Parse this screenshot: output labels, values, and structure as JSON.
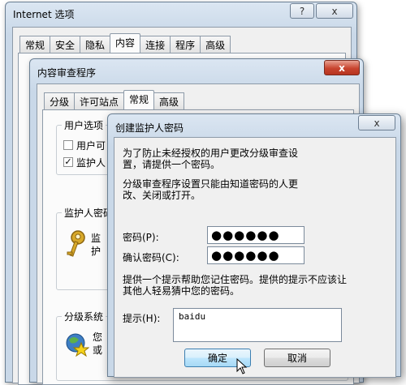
{
  "internet_options": {
    "title": "Internet 选项",
    "help_button": "?",
    "close_button": "x",
    "tabs": [
      "常规",
      "安全",
      "隐私",
      "内容",
      "连接",
      "程序",
      "高级"
    ],
    "active_tab": "内容"
  },
  "content_advisor": {
    "title": "内容审查程序",
    "close_button": "x",
    "tabs": [
      "分级",
      "许可站点",
      "常规",
      "高级"
    ],
    "active_tab": "常规",
    "user_options": {
      "title": "用户选项",
      "option1_partial": "用户可",
      "option2_partial": "监护人"
    },
    "supervisor_password": {
      "title": "监护人密码",
      "text_partial_line1": "监",
      "text_partial_line2": "护"
    },
    "rating_systems": {
      "title": "分级系统",
      "text_partial_line1": "您",
      "text_partial_line2": "或"
    }
  },
  "create_password": {
    "title": "创建监护人密码",
    "close_button": "x",
    "description1": "为了防止未经授权的用户更改分级审查设置，请提供一个密码。",
    "description2": "分级审查程序设置只能由知道密码的人更改、关闭或打开。",
    "password_label": "密码(P):",
    "password_value": "●●●●●●",
    "confirm_label": "确认密码(C):",
    "confirm_value": "●●●●●●",
    "hint_description": "提供一个提示帮助您记住密码。提供的提示不应该让其他人轻易猜中您的密码。",
    "hint_label": "提示(H):",
    "hint_value": "baidu",
    "ok_button": "确定",
    "cancel_button": "取消"
  }
}
